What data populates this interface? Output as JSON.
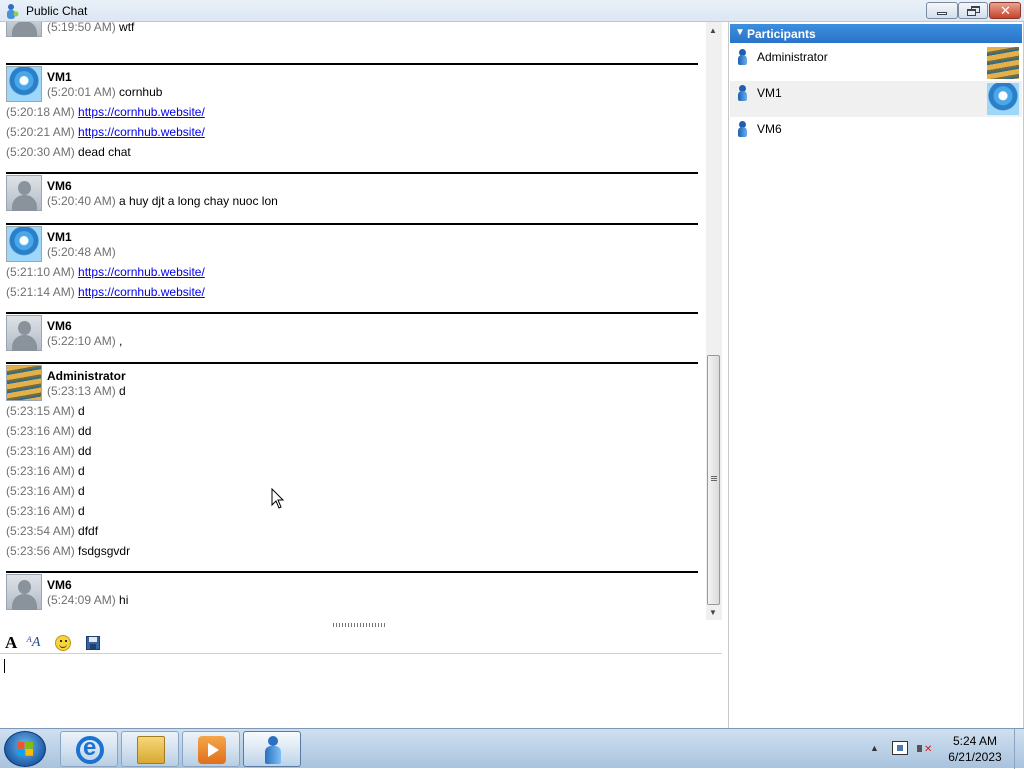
{
  "window": {
    "title": "Public Chat"
  },
  "chat": {
    "blocks": [
      {
        "sender": "VM6",
        "avatar": "user",
        "partial_top": true,
        "lines": [
          {
            "time": "(5:19:50 AM)",
            "text": "wtf"
          }
        ]
      },
      {
        "sender": "VM1",
        "avatar": "wheel",
        "lines": [
          {
            "time": "(5:20:01 AM)",
            "text": "cornhub"
          },
          {
            "time": "(5:20:18 AM)",
            "link": "https://cornhub.website/"
          },
          {
            "time": "(5:20:21 AM)",
            "link": "https://cornhub.website/"
          },
          {
            "time": "(5:20:30 AM)",
            "text": "dead chat"
          }
        ]
      },
      {
        "sender": "VM6",
        "avatar": "user",
        "lines": [
          {
            "time": "(5:20:40 AM)",
            "text": "a huy djt a long chay nuoc lon"
          }
        ]
      },
      {
        "sender": "VM1",
        "avatar": "wheel",
        "lines": [
          {
            "time": "(5:20:48 AM)",
            "text": ""
          },
          {
            "time": "(5:21:10 AM)",
            "link": "https://cornhub.website/"
          },
          {
            "time": "(5:21:14 AM)",
            "link": "https://cornhub.website/"
          }
        ]
      },
      {
        "sender": "VM6",
        "avatar": "user",
        "lines": [
          {
            "time": "(5:22:10 AM)",
            "text": ","
          }
        ]
      },
      {
        "sender": "Administrator",
        "avatar": "stairs",
        "lines": [
          {
            "time": "(5:23:13 AM)",
            "text": "d"
          },
          {
            "time": "(5:23:15 AM)",
            "text": "d"
          },
          {
            "time": "(5:23:16 AM)",
            "text": "dd"
          },
          {
            "time": "(5:23:16 AM)",
            "text": "dd"
          },
          {
            "time": "(5:23:16 AM)",
            "text": "d"
          },
          {
            "time": "(5:23:16 AM)",
            "text": "d"
          },
          {
            "time": "(5:23:16 AM)",
            "text": "d"
          },
          {
            "time": "(5:23:54 AM)",
            "text": "dfdf"
          },
          {
            "time": "(5:23:56 AM)",
            "text": "fsdgsgvdr"
          }
        ]
      },
      {
        "sender": "VM6",
        "avatar": "user",
        "lines": [
          {
            "time": "(5:24:09 AM)",
            "text": "hi"
          }
        ]
      }
    ]
  },
  "composer": {
    "value": "",
    "toolbar": [
      "font-icon",
      "text-color-icon",
      "emoticon-icon",
      "save-icon"
    ]
  },
  "participants": {
    "header": "Participants",
    "items": [
      {
        "name": "Administrator",
        "avatar": "stairs"
      },
      {
        "name": "VM1",
        "avatar": "wheel"
      },
      {
        "name": "VM6",
        "avatar": ""
      }
    ]
  },
  "taskbar": {
    "apps": [
      "internet-explorer-icon",
      "file-explorer-icon",
      "media-player-icon",
      "chat-app-icon"
    ],
    "active_app": "chat-app-icon",
    "clock_time": "5:24 AM",
    "clock_date": "6/21/2023"
  },
  "colors": {
    "timestamp": "#707070",
    "link": "#0000ee",
    "participants_header": "#2a74c8",
    "alt_row": "#f0f0f0"
  }
}
